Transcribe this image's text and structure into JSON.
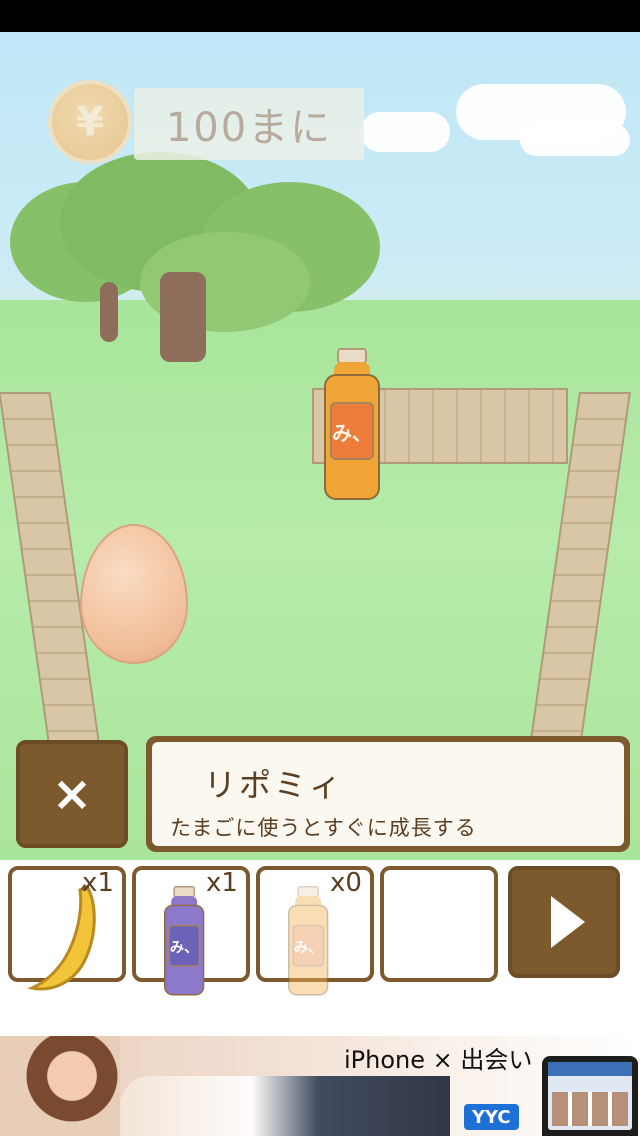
{
  "goal": {
    "text": "100まに",
    "coin_symbol": "¥"
  },
  "item_info": {
    "name": "リポミィ",
    "description": "たまごに使うとすぐに成長する",
    "close_symbol": "×"
  },
  "field": {
    "bottle_label": "み、"
  },
  "inventory": [
    {
      "item": "banana",
      "count": "x1"
    },
    {
      "item": "blue-drink",
      "label": "み、",
      "count": "x1"
    },
    {
      "item": "orange-drink",
      "label": "み、",
      "count": "x0"
    },
    {
      "item": "empty",
      "count": ""
    }
  ],
  "ad": {
    "headline": "iPhone × 出会い",
    "logo": "YYC"
  },
  "colors": {
    "panel_brown": "#7c5a2e",
    "grass": "#a8e59b",
    "sky": "#bfe7f7"
  }
}
